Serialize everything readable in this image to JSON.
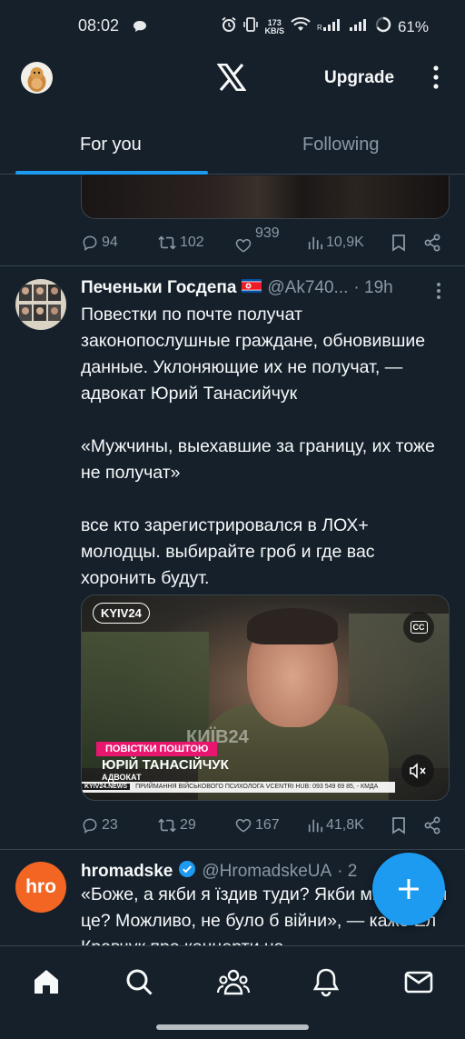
{
  "status_bar": {
    "time": "08:02",
    "net_speed_value": "173",
    "net_speed_unit": "KB/S",
    "battery": "61%"
  },
  "header": {
    "logo_icon": "x-logo-icon",
    "upgrade_label": "Upgrade"
  },
  "tabs": [
    {
      "label": "For you",
      "active": true
    },
    {
      "label": "Following",
      "active": false
    }
  ],
  "prev_tweet": {
    "replies": "94",
    "reposts": "102",
    "likes": "939",
    "views": "10,9K"
  },
  "tweet1": {
    "name": "Печеньки Госдепа",
    "handle": "@Ak740...",
    "time": "· 19h",
    "body": "Повестки по почте получат законопослушные граждане, обновившие данные. Уклоняющие их не получат, — адвокат Юрий Танасийчук\n\n«Мужчины, выехавшие за границу, их тоже не получат»\n\nвсе кто зарегистрировался в ЛОХ+ молодцы. выбирайте гроб и где вас хоронить будут.",
    "video": {
      "channel_logo": "KYIV24",
      "cc_label": "CC",
      "banner": "ПОВІСТКИ ПОШТОЮ",
      "person_name": "ЮРІЙ ТАНАСІЙЧУК",
      "person_role": "АДВОКАТ",
      "watermark": "КИЇВ24",
      "ticker_source": "KYIV24.NEWS",
      "ticker_text": "ПРИЙМАННЯ ВІЙСЬКОВОГО ПСИХОЛОГА VCENTRI HUB: 093 549 69 85, - КМДА"
    },
    "replies": "23",
    "reposts": "29",
    "likes": "167",
    "views": "41,8K"
  },
  "tweet2": {
    "avatar_text": "hro",
    "name": "hromadske",
    "handle": "@HromadskeUA",
    "time": "· 2",
    "body": "«Боже, а якби я їздив туди? Якби ми робили це? Можливо, не було б війни», — каже Ел Кравчук про концерти на"
  },
  "colors": {
    "background": "#15202b",
    "accent": "#1d9bf0",
    "muted": "#8b98a5",
    "border": "#38444d"
  }
}
